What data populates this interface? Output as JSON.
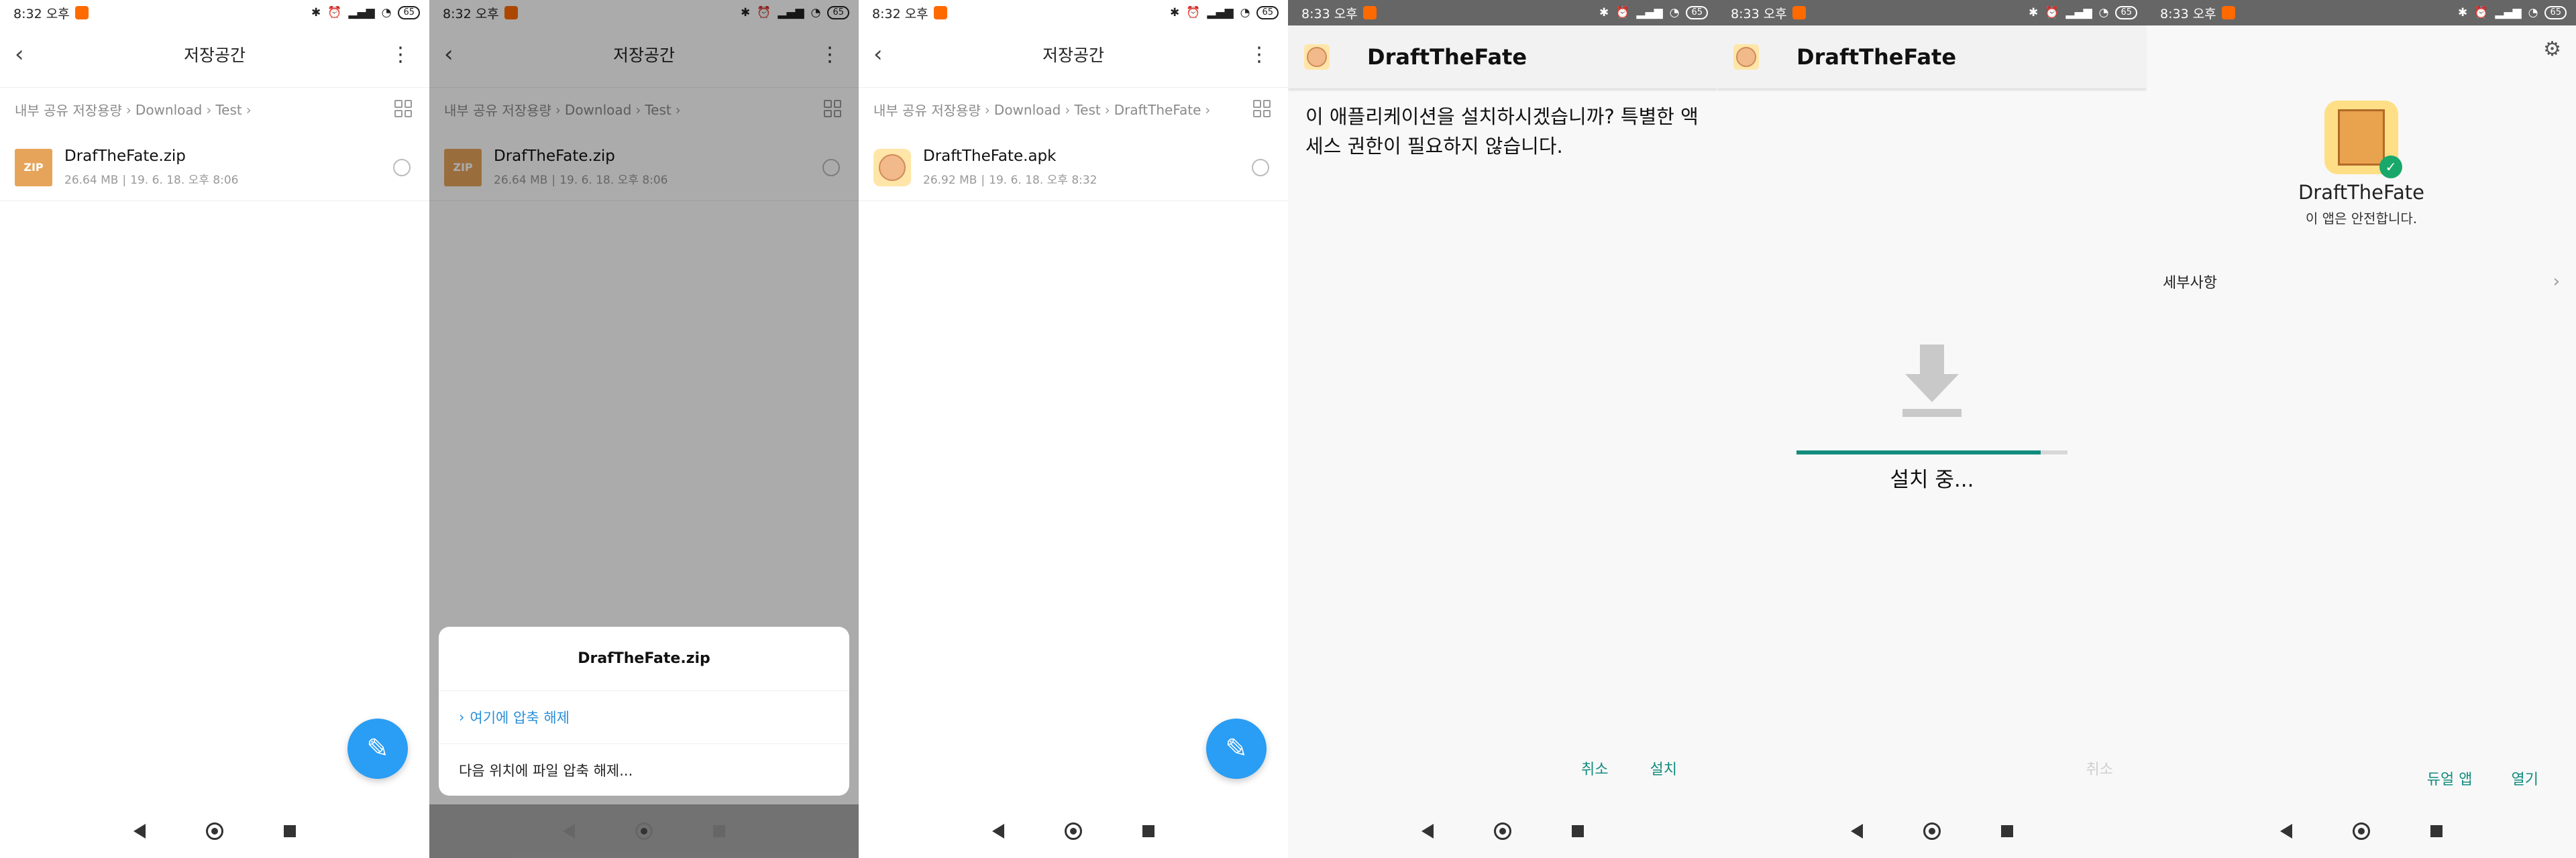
{
  "screens": [
    {
      "status": {
        "time": "8:32 오후",
        "battery": "65"
      },
      "title": "저장공간",
      "breadcrumb": [
        "내부 공유 저장용량",
        "Download",
        "Test"
      ],
      "file": {
        "name": "DrafTheFate.zip",
        "size": "26.64 MB",
        "date": "19. 6. 18. 오후 8:06",
        "icon_text": "ZIP"
      }
    },
    {
      "status": {
        "time": "8:32 오후",
        "battery": "65"
      },
      "title": "저장공간",
      "breadcrumb": [
        "내부 공유 저장용량",
        "Download",
        "Test"
      ],
      "file": {
        "name": "DrafTheFate.zip",
        "size": "26.64 MB",
        "date": "19. 6. 18. 오후 8:06",
        "icon_text": "ZIP"
      },
      "sheet": {
        "title": "DrafTheFate.zip",
        "items": [
          "여기에 압축 해제",
          "다음 위치에 파일 압축 해제..."
        ]
      }
    },
    {
      "status": {
        "time": "8:32 오후",
        "battery": "65"
      },
      "title": "저장공간",
      "breadcrumb": [
        "내부 공유 저장용량",
        "Download",
        "Test",
        "DraftTheFate"
      ],
      "file": {
        "name": "DraftTheFate.apk",
        "size": "26.92 MB",
        "date": "19. 6. 18. 오후 8:32"
      }
    },
    {
      "status": {
        "time": "8:33 오후",
        "battery": "65"
      },
      "app_title": "DraftTheFate",
      "message": "이 애플리케이션을 설치하시겠습니까? 특별한 액세스 권한이 필요하지 않습니다.",
      "actions": {
        "cancel": "취소",
        "install": "설치"
      }
    },
    {
      "status": {
        "time": "8:33 오후",
        "battery": "65"
      },
      "app_title": "DraftTheFate",
      "installing": "설치 중...",
      "progress": 0.9,
      "actions": {
        "cancel": "취소"
      }
    },
    {
      "status": {
        "time": "8:33 오후",
        "battery": "65"
      },
      "app_name": "DraftTheFate",
      "safe_text": "이 앱은 안전합니다.",
      "details_label": "세부사항",
      "actions": {
        "dual": "듀얼 앱",
        "open": "열기"
      }
    }
  ]
}
